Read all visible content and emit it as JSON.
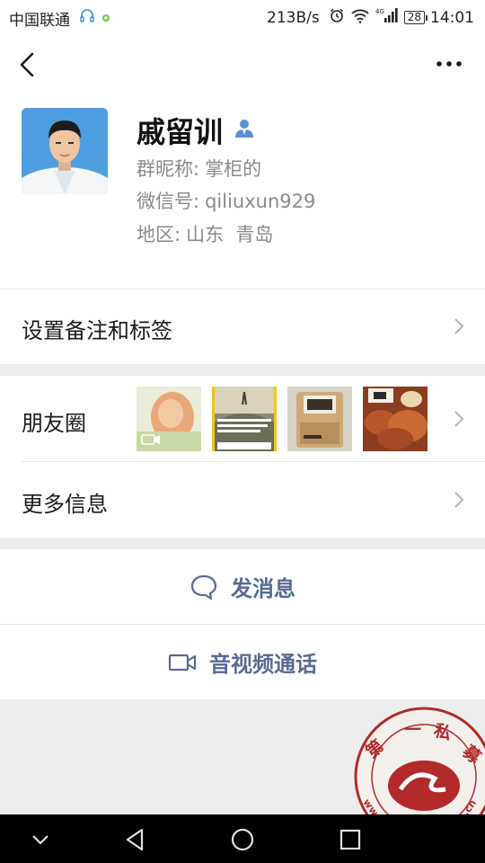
{
  "status_bar": {
    "carrier": "中国联通",
    "net_speed": "213B/s",
    "network": "4G",
    "battery": "28",
    "time": "14:01"
  },
  "header": {
    "back_icon": "chevron-left-icon",
    "more_icon": "more-dots-icon"
  },
  "profile": {
    "name": "戚留训",
    "group_nickname_label": "群昵称:",
    "group_nickname": "掌柜的",
    "wechat_id_label": "微信号:",
    "wechat_id": "qiliuxun929",
    "region_label": "地区:",
    "region": "山东  青岛"
  },
  "rows": {
    "remark_tags": "设置备注和标签",
    "moments": "朋友圈",
    "more_info": "更多信息"
  },
  "actions": {
    "send_message": "发消息",
    "video_call": "音视频通话"
  },
  "moments_thumbnails": [
    {
      "alt": "moment-photo-1"
    },
    {
      "alt": "moment-photo-2"
    },
    {
      "alt": "moment-photo-3"
    },
    {
      "alt": "moment-photo-4"
    }
  ],
  "watermark": {
    "top_text": "第一私募",
    "ring_text": "www.simuwu.cn"
  },
  "colors": {
    "action_text": "#576b95",
    "background": "#ededed",
    "nav_bar": "#000000"
  }
}
